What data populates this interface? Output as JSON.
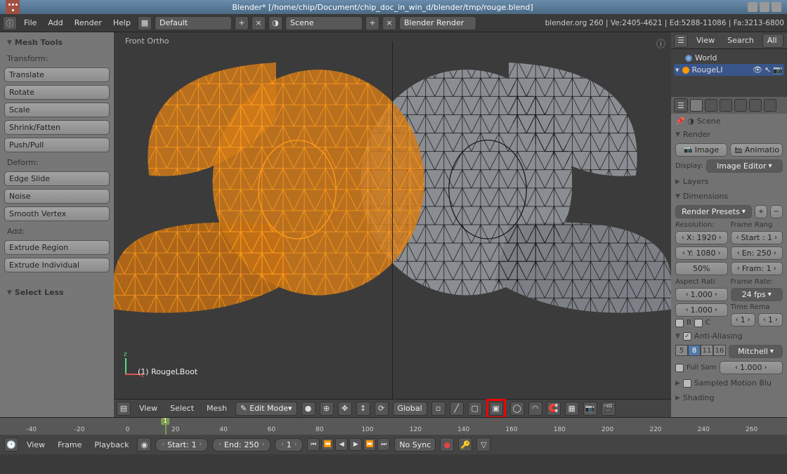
{
  "window": {
    "title": "Blender* [/home/chip/Document/chip_doc_in_win_d/blender/tmp/rouge.blend]"
  },
  "top_menu": {
    "items": [
      "File",
      "Add",
      "Render",
      "Help"
    ],
    "layout": "Default",
    "scene": "Scene",
    "engine": "Blender Render",
    "info": "blender.org 260 | Ve:2405-4621 | Ed:5288-11086 | Fa:3213-6800"
  },
  "tools": {
    "title": "Mesh Tools",
    "transform_label": "Transform:",
    "transform": [
      "Translate",
      "Rotate",
      "Scale",
      "Shrink/Fatten",
      "Push/Pull"
    ],
    "deform_label": "Deform:",
    "deform": [
      "Edge Slide",
      "Noise",
      "Smooth Vertex"
    ],
    "add_label": "Add:",
    "add": [
      "Extrude Region",
      "Extrude Individual"
    ],
    "last_op": "Select Less"
  },
  "viewport": {
    "persp": "Front Ortho",
    "object": "(1) RougeLBoot",
    "header_menus": [
      "View",
      "Select",
      "Mesh"
    ],
    "mode": "Edit Mode",
    "orientation": "Global"
  },
  "timeline": {
    "menus": [
      "View",
      "Frame",
      "Playback"
    ],
    "start_label": "Start:",
    "start": "1",
    "end_label": "End:",
    "end": "250",
    "current": "1",
    "ticks": [
      "-40",
      "-20",
      "0",
      "20",
      "40",
      "60",
      "80",
      "100",
      "120",
      "140",
      "160",
      "180",
      "200",
      "220",
      "240",
      "260"
    ],
    "sync": "No Sync"
  },
  "outliner": {
    "menus": [
      "View",
      "Search"
    ],
    "all": "All",
    "world": "World",
    "selected": "RougeLI"
  },
  "props": {
    "breadcrumb": "Scene",
    "render": {
      "title": "Render",
      "image": "Image",
      "anim": "Animatio",
      "display_label": "Display:",
      "display": "Image Editor"
    },
    "layers": "Layers",
    "dimensions": {
      "title": "Dimensions",
      "presets": "Render Presets",
      "res_label": "Resolution:",
      "frame_label": "Frame Rang",
      "x": "X: 1920",
      "y": "Y: 1080",
      "pct": "50%",
      "start": "Start : 1",
      "end": "En: 250",
      "step": "Fram: 1",
      "aspect_label": "Aspect Rati",
      "aspect_x": "1.000",
      "aspect_y": "1.000",
      "rate_label": "Frame Rate:",
      "rate": "24 fps",
      "time_label": "Time Rema",
      "b": "B",
      "c": "C",
      "old": "1",
      "new": "1"
    },
    "aa": {
      "title": "Anti-Aliasing",
      "samples": [
        "5",
        "8",
        "11",
        "16"
      ],
      "filter": "Mitchell",
      "fullsample": "Full Sam",
      "size": "1.000"
    },
    "motion_blur": "Sampled Motion Blu",
    "shading": "Shading"
  }
}
